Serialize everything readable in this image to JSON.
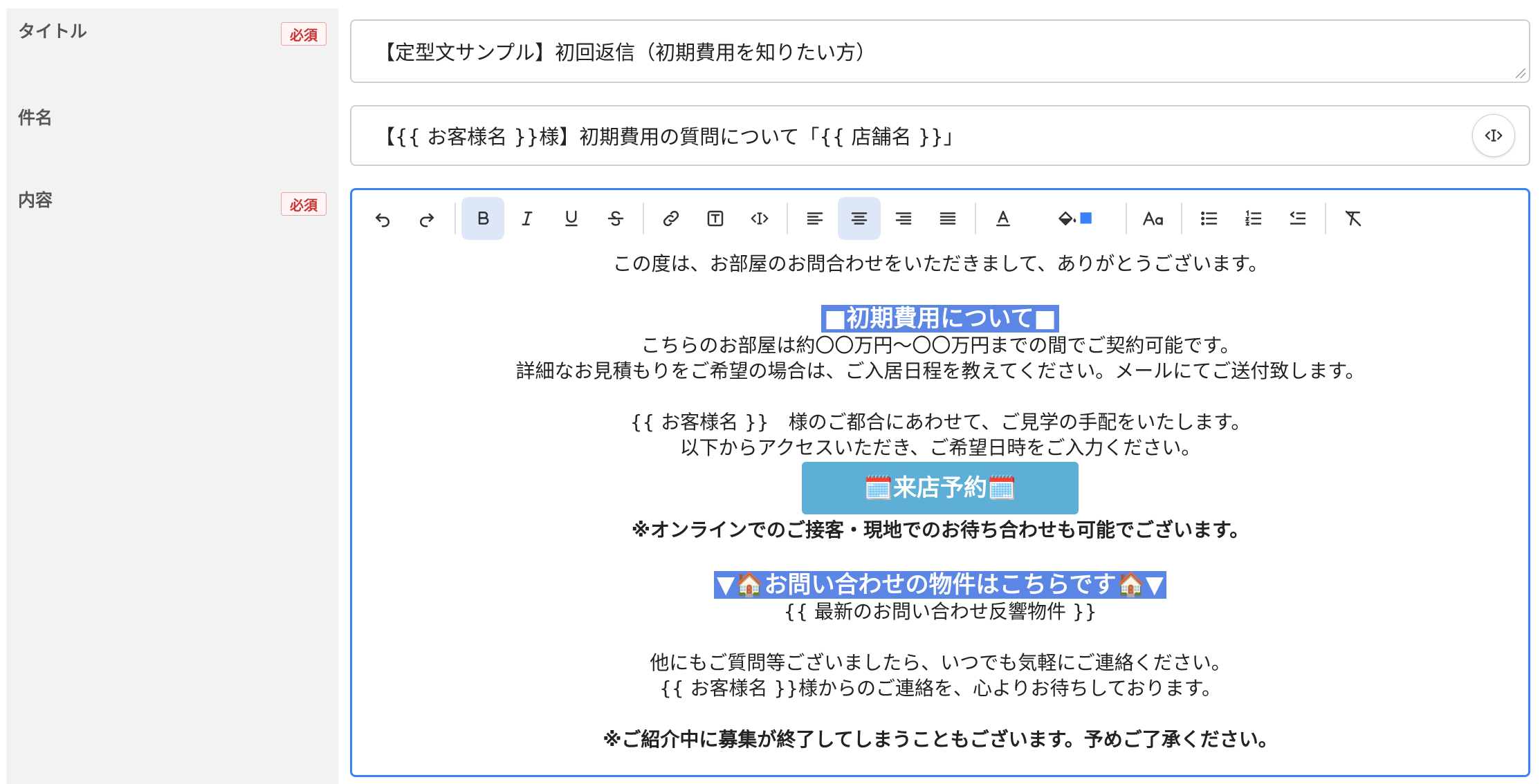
{
  "fields": {
    "title": {
      "label": "タイトル",
      "required": "必須",
      "value": "【定型文サンプル】初回返信（初期費用を知りたい方）"
    },
    "subject": {
      "label": "件名",
      "value": "【{{ お客様名 }}様】初期費用の質問について「{{ 店舗名 }}」"
    },
    "content": {
      "label": "内容",
      "required": "必須"
    }
  },
  "toolbar_icons": [
    "undo-icon",
    "redo-icon",
    "bold-icon",
    "italic-icon",
    "underline-icon",
    "strikethrough-icon",
    "link-icon",
    "text-box-icon",
    "variable-icon",
    "align-left-icon",
    "align-center-icon",
    "align-right-icon",
    "align-justify-icon",
    "text-color-icon",
    "fill-color-icon",
    "font-size-icon",
    "bullet-list-icon",
    "numbered-list-icon",
    "outdent-icon",
    "clear-format-icon"
  ],
  "colors": {
    "accent": "#3b82f6",
    "required": "#cc3333",
    "highlight": "#5b86e5",
    "button": "#5eafd6",
    "fill_swatch": "#3b82f6"
  },
  "editor": {
    "line1": "この度は、お部屋のお問合わせをいただきまして、ありがとうございます。",
    "heading1": "■初期費用について■",
    "line2": "こちらのお部屋は約〇〇万円〜〇〇万円までの間でご契約可能です。",
    "line3": "詳細なお見積もりをご希望の場合は、ご入居日程を教えてください。メールにてご送付致します。",
    "line4": "{{ お客様名 }}　様のご都合にあわせて、ご見学の手配をいたします。",
    "line5": "以下からアクセスいただき、ご希望日時をご入力ください。",
    "reserve_button": "🗓️来店予約🗓️",
    "line6": "※オンラインでのご接客・現地でのお待ち合わせも可能でございます。",
    "heading2": "▼🏠お問い合わせの物件はこちらです🏠▼",
    "line7": "{{ 最新のお問い合わせ反響物件 }}",
    "line8": "他にもご質問等ございましたら、いつでも気軽にご連絡ください。",
    "line9": "{{ お客様名 }}様からのご連絡を、心よりお待ちしております。",
    "line10": "※ご紹介中に募集が終了してしまうこともございます。予めご了承ください。"
  }
}
